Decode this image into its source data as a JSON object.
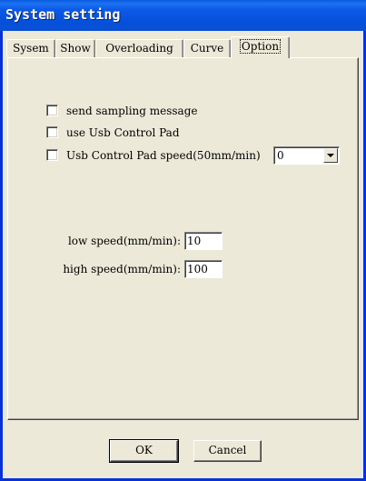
{
  "window": {
    "title": "System setting"
  },
  "tabs": [
    {
      "label": "Sysem"
    },
    {
      "label": "Show"
    },
    {
      "label": "Overloading"
    },
    {
      "label": "Curve"
    },
    {
      "label": "Option"
    }
  ],
  "options": {
    "send_sampling": {
      "label": "send sampling message",
      "checked": false
    },
    "use_usb_pad": {
      "label": "use Usb Control Pad",
      "checked": false
    },
    "usb_pad_speed": {
      "label": "Usb Control Pad speed(50mm/min)",
      "checked": false,
      "selected": "0"
    }
  },
  "speeds": {
    "low": {
      "label": "low speed(mm/min):",
      "value": "10"
    },
    "high": {
      "label": "high speed(mm/min):",
      "value": "100"
    }
  },
  "buttons": {
    "ok": "OK",
    "cancel": "Cancel"
  }
}
